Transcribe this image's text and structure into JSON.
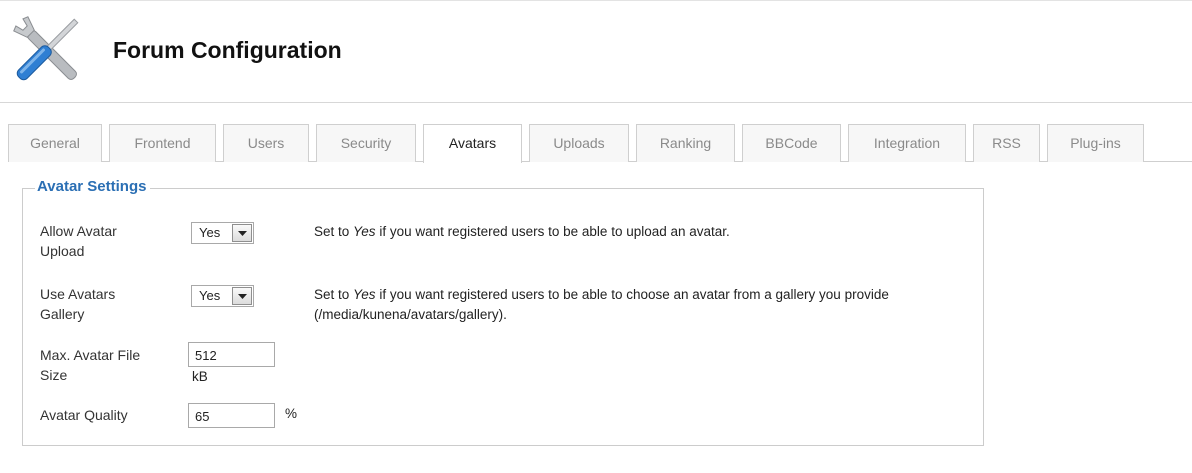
{
  "header": {
    "title": "Forum Configuration",
    "icon": "tools-icon"
  },
  "tabs": [
    {
      "label": "General"
    },
    {
      "label": "Frontend"
    },
    {
      "label": "Users"
    },
    {
      "label": "Security"
    },
    {
      "label": "Avatars",
      "active": true
    },
    {
      "label": "Uploads"
    },
    {
      "label": "Ranking"
    },
    {
      "label": "BBCode"
    },
    {
      "label": "Integration"
    },
    {
      "label": "RSS"
    },
    {
      "label": "Plug-ins"
    }
  ],
  "section": {
    "legend": "Avatar Settings",
    "colors": {
      "legend": "#2b6fb4",
      "border": "#cccccc"
    }
  },
  "settings": {
    "allow_upload": {
      "label_line1": "Allow Avatar",
      "label_line2": "Upload",
      "value": "Yes",
      "desc_pre": "Set to ",
      "desc_em": "Yes",
      "desc_post": " if you want registered users to be able to upload an avatar."
    },
    "gallery": {
      "label_line1": "Use Avatars",
      "label_line2": "Gallery",
      "value": "Yes",
      "desc_pre": "Set to ",
      "desc_em": "Yes",
      "desc_post": " if you want registered users to be able to choose an avatar from a gallery you provide",
      "desc_line2": "(/media/kunena/avatars/gallery)."
    },
    "file_size": {
      "label_line1": "Max. Avatar File",
      "label_line2": "Size",
      "value": "512",
      "unit": "kB"
    },
    "quality": {
      "label": "Avatar Quality",
      "value": "65",
      "unit": "%"
    }
  }
}
